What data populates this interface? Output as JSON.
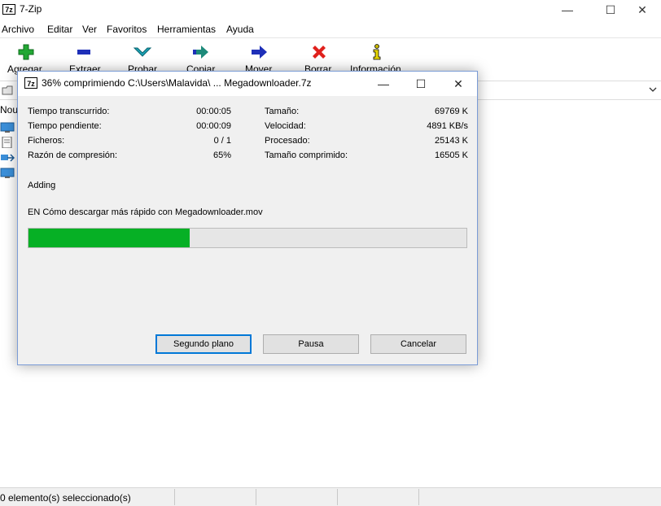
{
  "window": {
    "title": "7-Zip",
    "logo_text": "7z",
    "minimize": "—",
    "maximize": "☐",
    "close": "✕"
  },
  "menu": [
    "Archivo",
    "Editar",
    "Ver",
    "Favoritos",
    "Herramientas",
    "Ayuda"
  ],
  "toolbar": [
    {
      "label": "Agregar",
      "icon": "plus-icon",
      "color": "#22a834"
    },
    {
      "label": "Extraer",
      "icon": "minus-icon",
      "color": "#1e2fb8"
    },
    {
      "label": "Probar",
      "icon": "check-icon",
      "color": "#1ba3b5"
    },
    {
      "label": "Copiar",
      "icon": "copy-arrow-icon",
      "color": "#1d8a7a"
    },
    {
      "label": "Mover",
      "icon": "move-arrow-icon",
      "color": "#1e2fb8"
    },
    {
      "label": "Borrar",
      "icon": "delete-x-icon",
      "color": "#e0201c"
    },
    {
      "label": "Información",
      "icon": "info-icon",
      "color": "#c9b800"
    }
  ],
  "list": {
    "column_header": "Nou"
  },
  "status": {
    "text": "0 elemento(s) seleccionado(s)"
  },
  "dialog": {
    "logo_text": "7z",
    "title": "36% comprimiendo C:\\Users\\Malavida\\ ...  Megadownloader.7z",
    "minimize": "—",
    "maximize": "☐",
    "close": "✕",
    "left_stats": [
      {
        "label": "Tiempo transcurrido:",
        "value": "00:00:05"
      },
      {
        "label": "Tiempo pendiente:",
        "value": "00:00:09"
      },
      {
        "label": "Ficheros:",
        "value": "0 / 1"
      },
      {
        "label": "Razón de compresión:",
        "value": "65%"
      }
    ],
    "right_stats": [
      {
        "label": "Tamaño:",
        "value": "69769 K"
      },
      {
        "label": "Velocidad:",
        "value": "4891 KB/s"
      },
      {
        "label": "Procesado:",
        "value": "25143 K"
      },
      {
        "label": "Tamaño comprimido:",
        "value": "16505 K"
      }
    ],
    "operation": "Adding",
    "current_file": "EN Cómo descargar más rápido con Megadownloader.mov",
    "progress_percent": 36.8,
    "progress_color": "#06b025",
    "buttons": {
      "background": "Segundo plano",
      "pause": "Pausa",
      "cancel": "Cancelar"
    }
  }
}
